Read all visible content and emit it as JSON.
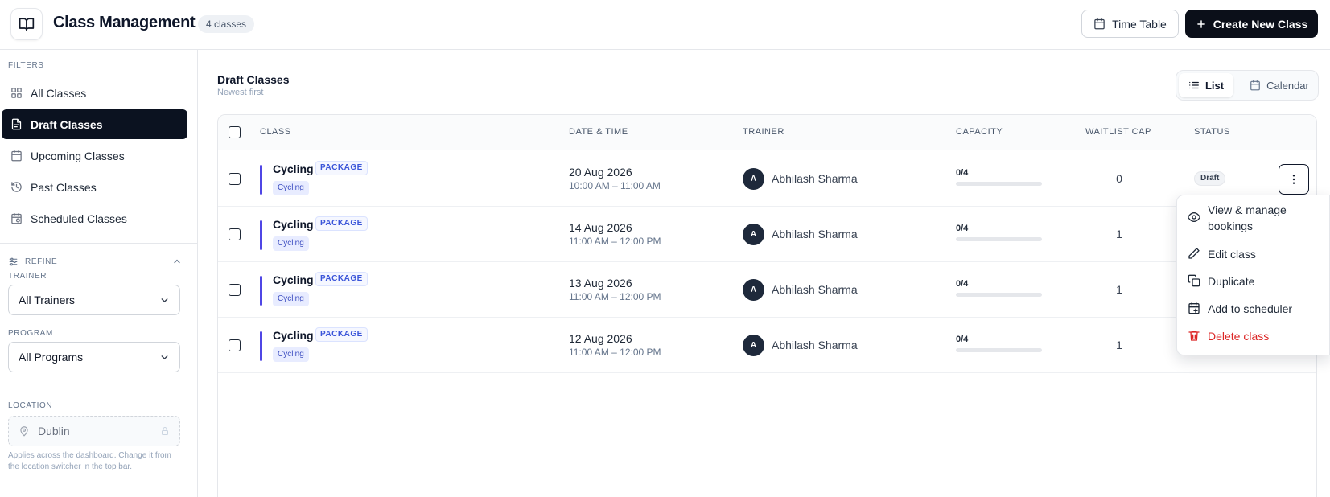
{
  "header": {
    "title": "Class Management",
    "count_badge": "4 classes",
    "timetable_label": "Time Table",
    "create_label": "Create New Class"
  },
  "sidebar": {
    "filters_label": "FILTERS",
    "items": [
      {
        "label": "All Classes",
        "icon": "grid-icon",
        "active": false
      },
      {
        "label": "Draft Classes",
        "icon": "document-icon",
        "active": true
      },
      {
        "label": "Upcoming Classes",
        "icon": "calendar-icon",
        "active": false
      },
      {
        "label": "Past Classes",
        "icon": "history-icon",
        "active": false
      },
      {
        "label": "Scheduled Classes",
        "icon": "calendar-clock-icon",
        "active": false
      }
    ],
    "refine_label": "REFINE",
    "trainer_label": "TRAINER",
    "trainer_value": "All Trainers",
    "program_label": "PROGRAM",
    "program_value": "All Programs",
    "location_label": "LOCATION",
    "location_value": "Dublin",
    "help_text": "Applies across the dashboard. Change it from the location switcher in the top bar."
  },
  "main": {
    "title": "Draft Classes",
    "subtitle": "Newest first",
    "view_list": "List",
    "view_calendar": "Calendar",
    "columns": [
      "CLASS",
      "DATE & TIME",
      "TRAINER",
      "CAPACITY",
      "WAITLIST CAP",
      "STATUS"
    ],
    "rows": [
      {
        "name": "Cycling",
        "badge": "PACKAGE",
        "tag": "Cycling",
        "date": "20 Aug 2026",
        "time": "10:00 AM – 11:00 AM",
        "avatar": "A",
        "trainer": "Abhilash Sharma",
        "capacity": "0/4",
        "capacity_fraction": 0,
        "waitlist": "0",
        "status": "Draft"
      },
      {
        "name": "Cycling",
        "badge": "PACKAGE",
        "tag": "Cycling",
        "date": "14 Aug 2026",
        "time": "11:00 AM – 12:00 PM",
        "avatar": "A",
        "trainer": "Abhilash Sharma",
        "capacity": "0/4",
        "capacity_fraction": 0,
        "waitlist": "1",
        "status": ""
      },
      {
        "name": "Cycling",
        "badge": "PACKAGE",
        "tag": "Cycling",
        "date": "13 Aug 2026",
        "time": "11:00 AM – 12:00 PM",
        "avatar": "A",
        "trainer": "Abhilash Sharma",
        "capacity": "0/4",
        "capacity_fraction": 0,
        "waitlist": "1",
        "status": ""
      },
      {
        "name": "Cycling",
        "badge": "PACKAGE",
        "tag": "Cycling",
        "date": "12 Aug 2026",
        "time": "11:00 AM – 12:00 PM",
        "avatar": "A",
        "trainer": "Abhilash Sharma",
        "capacity": "0/4",
        "capacity_fraction": 0,
        "waitlist": "1",
        "status": ""
      }
    ]
  },
  "menu": {
    "items": [
      {
        "label": "View & manage bookings",
        "icon": "eye-icon",
        "danger": false
      },
      {
        "label": "Edit class",
        "icon": "pencil-icon",
        "danger": false
      },
      {
        "label": "Duplicate",
        "icon": "copy-icon",
        "danger": false
      },
      {
        "label": "Add to scheduler",
        "icon": "calendar-plus-icon",
        "danger": false
      },
      {
        "label": "Delete class",
        "icon": "trash-icon",
        "danger": true
      }
    ]
  },
  "colors": {
    "accent": "#4f46e5",
    "dark": "#0b0f19",
    "danger": "#dc2626"
  }
}
